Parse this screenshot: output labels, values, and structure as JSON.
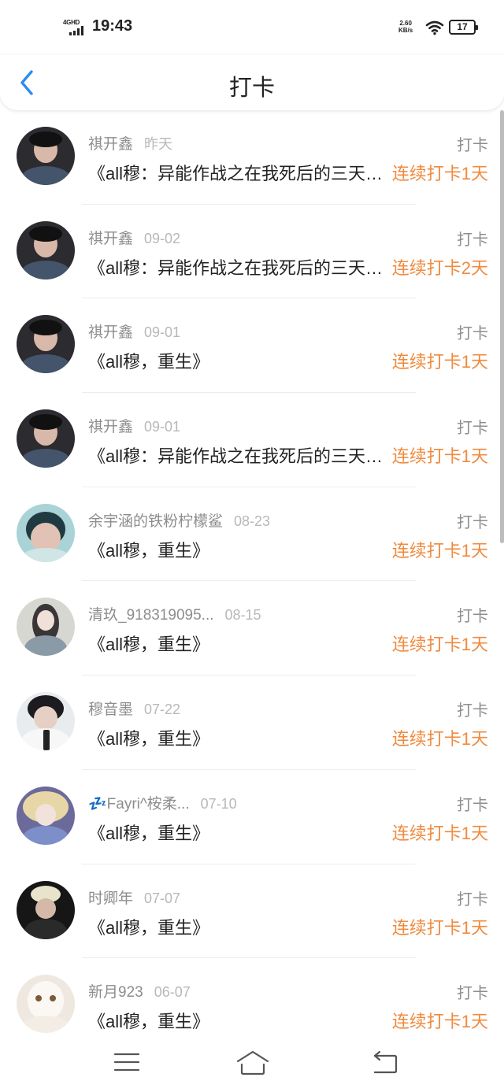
{
  "status": {
    "network": "4GHD",
    "time": "19:43",
    "speed_value": "2.60",
    "speed_unit": "KB/s",
    "battery": "17"
  },
  "header": {
    "title": "打卡"
  },
  "rows": [
    {
      "user": "祺开鑫",
      "date": "昨天",
      "title": "《all穆：异能作战之在我死后的三天（完结）》",
      "label": "打卡",
      "streak": "连续打卡1天"
    },
    {
      "user": "祺开鑫",
      "date": "09-02",
      "title": "《all穆：异能作战之在我死后的三天（完结）》",
      "label": "打卡",
      "streak": "连续打卡2天"
    },
    {
      "user": "祺开鑫",
      "date": "09-01",
      "title": "《all穆，重生》",
      "label": "打卡",
      "streak": "连续打卡1天"
    },
    {
      "user": "祺开鑫",
      "date": "09-01",
      "title": "《all穆：异能作战之在我死后的三天（完结）》",
      "label": "打卡",
      "streak": "连续打卡1天"
    },
    {
      "user": "余宇涵的铁粉柠檬鲨",
      "date": "08-23",
      "title": "《all穆，重生》",
      "label": "打卡",
      "streak": "连续打卡1天"
    },
    {
      "user": "清玖_918319095...",
      "date": "08-15",
      "title": "《all穆，重生》",
      "label": "打卡",
      "streak": "连续打卡1天"
    },
    {
      "user": "穆音墨",
      "date": "07-22",
      "title": "《all穆，重生》",
      "label": "打卡",
      "streak": "连续打卡1天"
    },
    {
      "user": "💤Fayri^桉柔...",
      "date": "07-10",
      "title": "《all穆，重生》",
      "label": "打卡",
      "streak": "连续打卡1天"
    },
    {
      "user": "时卿年",
      "date": "07-07",
      "title": "《all穆，重生》",
      "label": "打卡",
      "streak": "连续打卡1天"
    },
    {
      "user": "新月923",
      "date": "06-07",
      "title": "《all穆，重生》",
      "label": "打卡",
      "streak": "连续打卡1天"
    }
  ],
  "colors": {
    "accent": "#2f8bf0",
    "streak": "#f08a3e",
    "secondary_text": "#8d8d8d",
    "date_text": "#b8b8b8"
  },
  "icons": {
    "back": "chevron-left-icon",
    "menu": "menu-icon",
    "home": "home-icon",
    "return": "return-icon"
  }
}
